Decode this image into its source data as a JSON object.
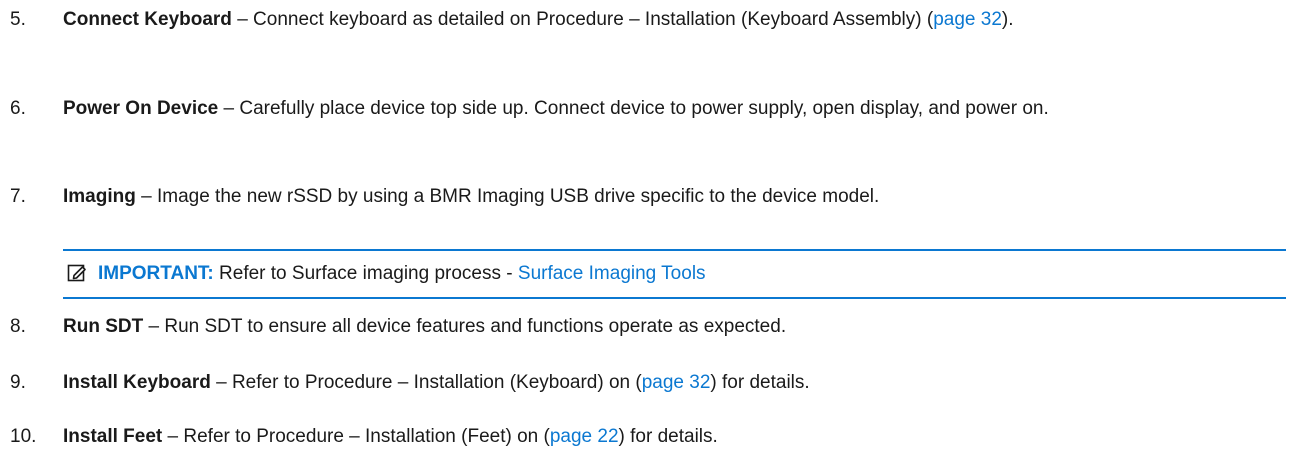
{
  "steps": [
    {
      "number": "5.",
      "title": "Connect Keyboard",
      "sep": " – ",
      "text_before": "Connect keyboard as detailed on Procedure – Installation (Keyboard Assembly) (",
      "link": "page 32",
      "text_after": ")."
    },
    {
      "number": "6.",
      "title": "Power On Device",
      "sep": " – ",
      "text": "Carefully place device top side up. Connect device to power supply, open display, and power on."
    },
    {
      "number": "7.",
      "title": "Imaging",
      "sep": " – ",
      "text": "Image the new rSSD by using a BMR Imaging USB drive specific to the device model."
    },
    {
      "number": "8.",
      "title": "Run SDT",
      "sep": " – ",
      "text": "Run SDT to ensure all device features and functions operate as expected."
    },
    {
      "number": "9.",
      "title": "Install Keyboard",
      "sep": " – ",
      "text_before": "Refer to Procedure – Installation (Keyboard) on (",
      "link": "page 32",
      "text_after": ") for details."
    },
    {
      "number": "10.",
      "title": "Install Feet",
      "sep": " – ",
      "text_before": "Refer to Procedure – Installation (Feet) on (",
      "link": "page 22",
      "text_after": ") for details."
    }
  ],
  "callout": {
    "icon": "note-edit-icon",
    "label": "IMPORTANT:",
    "text": " Refer to Surface imaging process - ",
    "link": "Surface Imaging Tools"
  },
  "colors": {
    "link": "#0b78d1",
    "text": "#1a1a1a",
    "rule": "#0b78d1"
  }
}
